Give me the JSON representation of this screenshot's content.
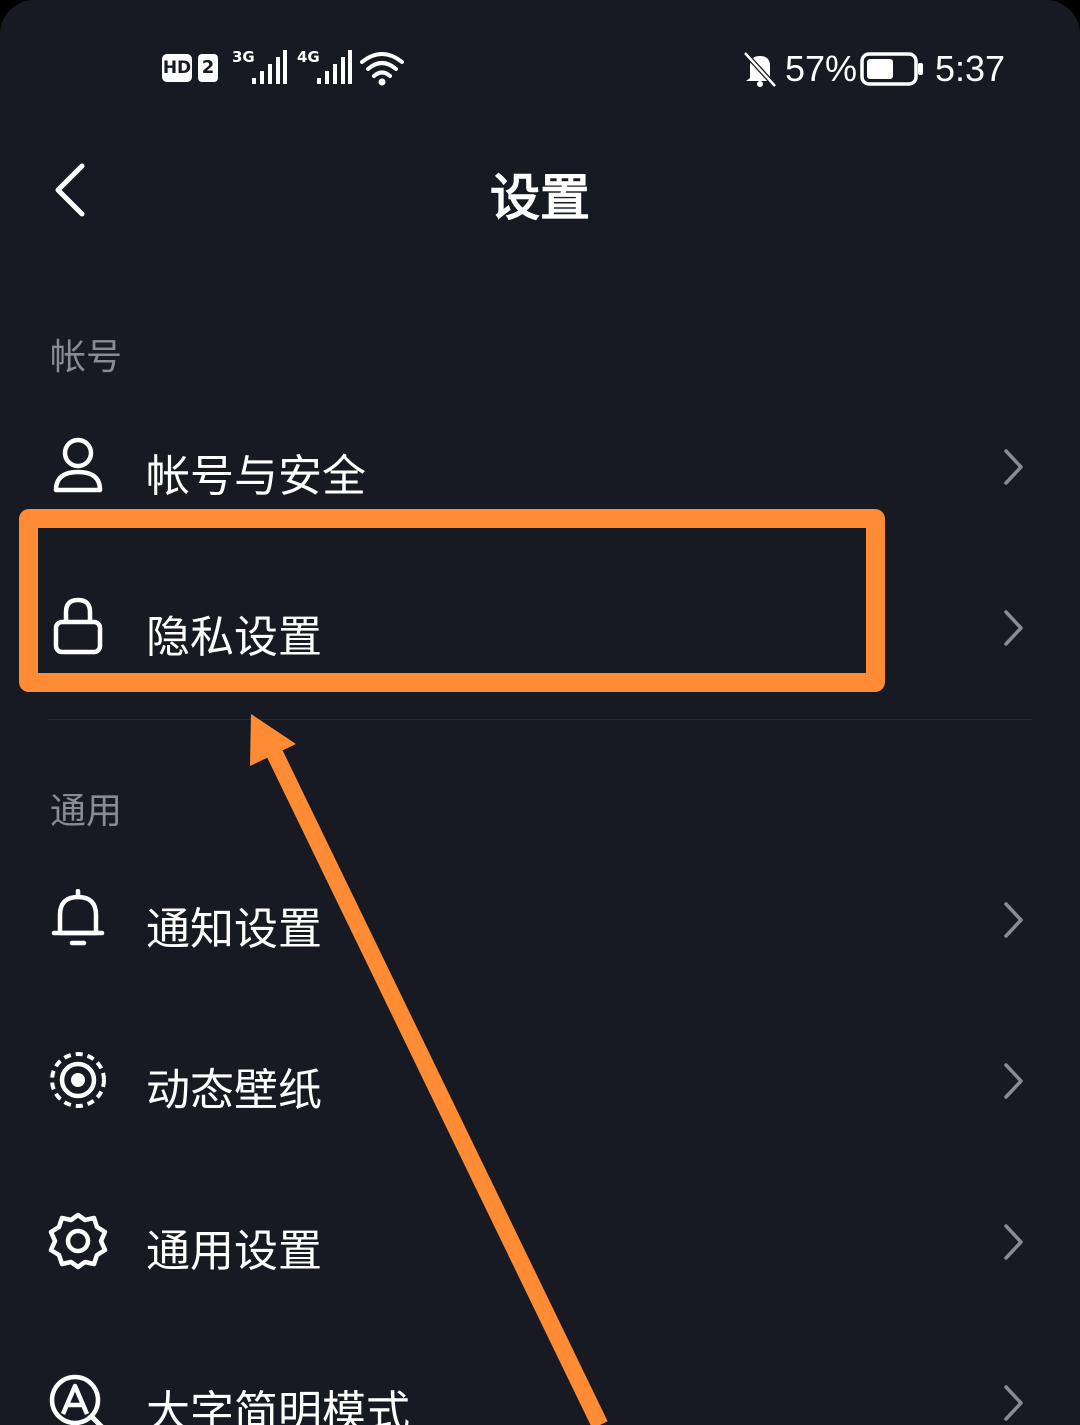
{
  "status_bar": {
    "hd_badge": "HD",
    "sim_badge": "2",
    "network1": "3G",
    "network2": "4G",
    "battery_percent": "57%",
    "time": "5:37",
    "icons": [
      "signal-icon",
      "wifi-icon",
      "mute-bell-icon",
      "battery-icon"
    ]
  },
  "header": {
    "title": "设置",
    "back_icon": "chevron-left-icon"
  },
  "sections": [
    {
      "label": "帐号",
      "items": [
        {
          "label": "帐号与安全",
          "icon": "user-icon"
        },
        {
          "label": "隐私设置",
          "icon": "lock-icon",
          "highlighted": true
        }
      ]
    },
    {
      "label": "通用",
      "items": [
        {
          "label": "通知设置",
          "icon": "bell-icon"
        },
        {
          "label": "动态壁纸",
          "icon": "live-wallpaper-icon"
        },
        {
          "label": "通用设置",
          "icon": "gear-icon"
        },
        {
          "label": "大字简明模式",
          "icon": "large-font-icon"
        }
      ]
    }
  ],
  "colors": {
    "background": "#181a23",
    "text": "#ffffff",
    "section_label": "#8a8c94",
    "annotation": "#ff8b35"
  }
}
